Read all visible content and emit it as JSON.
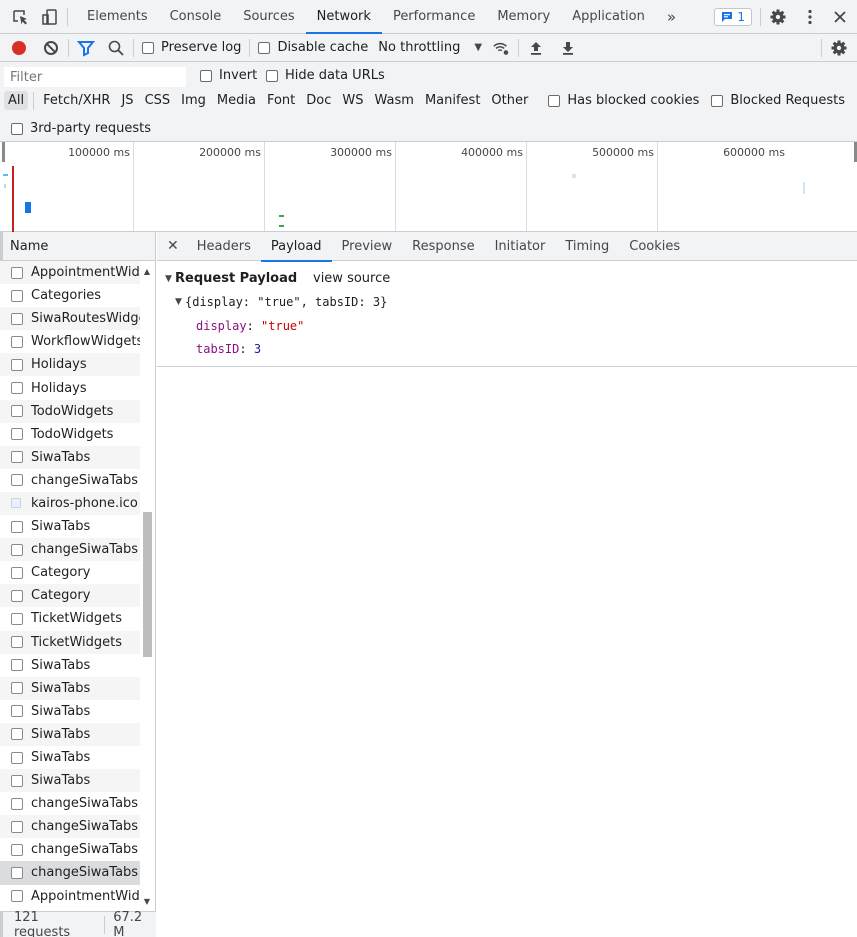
{
  "tabbar": {
    "tabs": [
      "Elements",
      "Console",
      "Sources",
      "Network",
      "Performance",
      "Memory",
      "Application"
    ],
    "active_tab": "Network",
    "more_tabs": "»",
    "messages_count": "1"
  },
  "toolbar": {
    "preserve_log": "Preserve log",
    "disable_cache": "Disable cache",
    "throttling": "No throttling"
  },
  "filter": {
    "placeholder": "Filter",
    "invert": "Invert",
    "hide_data_urls": "Hide data URLs",
    "types": [
      "All",
      "Fetch/XHR",
      "JS",
      "CSS",
      "Img",
      "Media",
      "Font",
      "Doc",
      "WS",
      "Wasm",
      "Manifest",
      "Other"
    ],
    "active_type": "All",
    "has_blocked_cookies": "Has blocked cookies",
    "blocked_requests": "Blocked Requests",
    "third_party": "3rd-party requests"
  },
  "overview": {
    "ticks": [
      "100000 ms",
      "200000 ms",
      "300000 ms",
      "400000 ms",
      "500000 ms",
      "600000 ms"
    ]
  },
  "requests": {
    "header": "Name",
    "rows": [
      "AppointmentWid...",
      "Categories",
      "SiwaRoutesWidget",
      "WorkflowWidgets",
      "Holidays",
      "Holidays",
      "TodoWidgets",
      "TodoWidgets",
      "SiwaTabs",
      "changeSiwaTabs",
      "kairos-phone.ico",
      "SiwaTabs",
      "changeSiwaTabs",
      "Category",
      "Category",
      "TicketWidgets",
      "TicketWidgets",
      "SiwaTabs",
      "SiwaTabs",
      "SiwaTabs",
      "SiwaTabs",
      "SiwaTabs",
      "SiwaTabs",
      "changeSiwaTabs",
      "changeSiwaTabs",
      "changeSiwaTabs",
      "changeSiwaTabs",
      "AppointmentWid..."
    ],
    "selected_index": 26,
    "count": "121 requests",
    "size": "67.2 M"
  },
  "detail": {
    "tabs": [
      "Headers",
      "Payload",
      "Preview",
      "Response",
      "Initiator",
      "Timing",
      "Cookies"
    ],
    "active_tab": "Payload",
    "section_title": "Request Payload",
    "view_source": "view source",
    "summary": "{display: \"true\", tabsID: 3}",
    "fields": [
      {
        "key": "display",
        "value": "\"true\"",
        "type": "string"
      },
      {
        "key": "tabsID",
        "value": "3",
        "type": "number"
      }
    ]
  }
}
